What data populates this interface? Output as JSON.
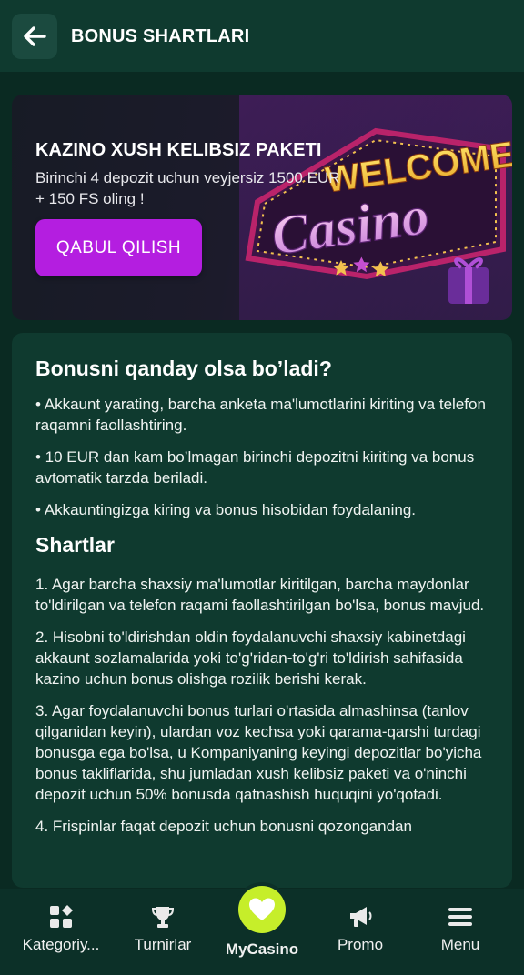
{
  "header": {
    "title": "BONUS SHARTLARI",
    "back_icon": "arrow-left-icon"
  },
  "banner": {
    "title": "KAZINO XUSH KELIBSIZ PAKETI",
    "subtitle": "Birinchi 4 depozit uchun veyjersiz 1500 EUR + 150 FS oling !",
    "cta_label": "QABUL QILISH",
    "art_line1": "WELCOME",
    "art_line2": "Casino",
    "cta_color": "#b41ee0"
  },
  "content": {
    "how_title": "Bonusni qanday olsa bo’ladi?",
    "how_items": [
      "• Akkaunt yarating, barcha anketa ma'lumotlarini kiriting va telefon raqamni faollashtiring.",
      "• 10 EUR dan kam bo’lmagan birinchi depozitni kiriting va bonus avtomatik tarzda beriladi.",
      "• Akkauntingizga kiring va bonus hisobidan foydalaning."
    ],
    "terms_title": "Shartlar",
    "terms_items": [
      "1. Agar barcha shaxsiy ma'lumotlar kiritilgan, barcha maydonlar to'ldirilgan va telefon raqami faollashtirilgan bo'lsa, bonus mavjud.",
      "2. Hisobni to'ldirishdan oldin foydalanuvchi shaxsiy kabinetdagi akkaunt sozlamalarida yoki to'g'ridan-to'g'ri to'ldirish sahifasida kazino uchun bonus olishga rozilik berishi kerak.",
      "3. Agar foydalanuvchi bonus turlari o'rtasida almashinsa (tanlov qilganidan keyin), ulardan voz kechsa yoki qarama-qarshi turdagi bonusga ega bo'lsa, u Kompaniyaning keyingi depozitlar bo'yicha bonus takliflarida, shu jumladan xush kelibsiz paketi va o'ninchi depozit uchun 50% bonusda qatnashish huquqini yo'qotadi.",
      "4. Frispinlar faqat depozit uchun bonusni qozongandan"
    ]
  },
  "nav": {
    "items": [
      {
        "label": "Kategoriy...",
        "icon": "categories-icon"
      },
      {
        "label": "Turnirlar",
        "icon": "trophy-icon"
      },
      {
        "label": "MyCasino",
        "icon": "heart-icon"
      },
      {
        "label": "Promo",
        "icon": "megaphone-icon"
      },
      {
        "label": "Menu",
        "icon": "hamburger-menu-icon"
      }
    ],
    "active_color": "#c6ee2a"
  }
}
